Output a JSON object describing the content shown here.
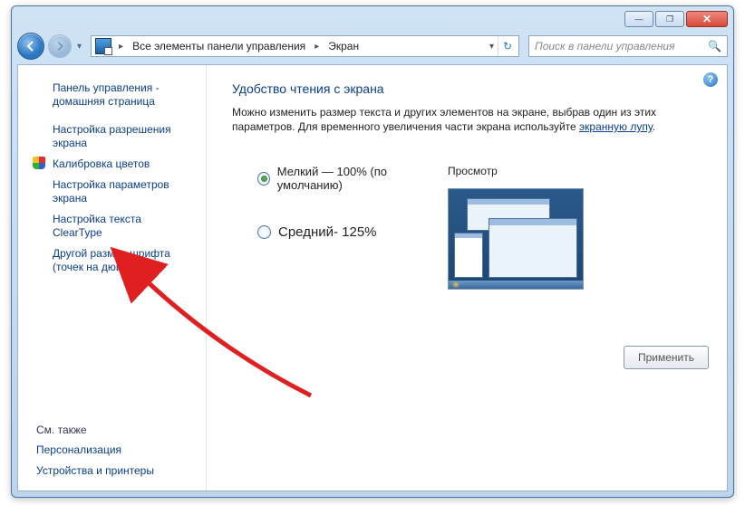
{
  "window_controls": {
    "min": "—",
    "max": "❐",
    "close": "✕"
  },
  "breadcrumb": {
    "seg1": "Все элементы панели управления",
    "seg2": "Экран"
  },
  "search": {
    "placeholder": "Поиск в панели управления"
  },
  "sidebar": {
    "items": [
      "Панель управления - домашняя страница",
      "Настройка разрешения экрана",
      "Калибровка цветов",
      "Настройка параметров экрана",
      "Настройка текста ClearType",
      "Другой размер шрифта (точек на дюйм)"
    ],
    "see_also_heading": "См. также",
    "see_also": [
      "Персонализация",
      "Устройства и принтеры"
    ]
  },
  "main": {
    "heading": "Удобство чтения с экрана",
    "desc_before": "Можно изменить размер текста и других элементов на экране, выбрав один из этих параметров. Для временного увеличения части экрана используйте ",
    "desc_link": "экранную лупу",
    "desc_after": ".",
    "opt_small": "Мелкий — 100% (по умолчанию)",
    "opt_medium": "Средний- 125%",
    "preview_label": "Просмотр",
    "apply": "Применить"
  }
}
